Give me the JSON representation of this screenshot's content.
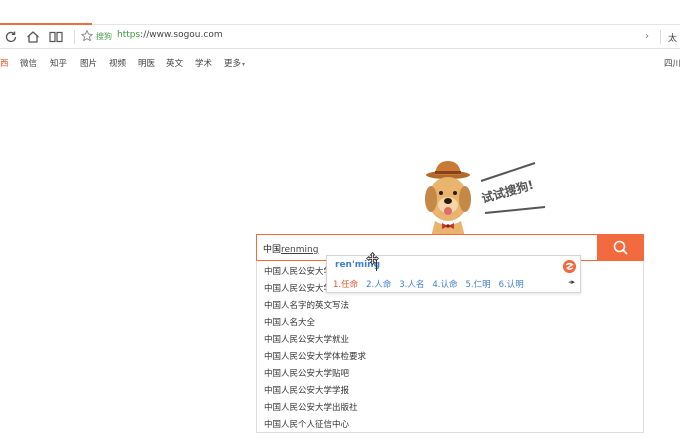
{
  "browser": {
    "url_scheme": "https",
    "url_rest": "://www.sogou.com",
    "site_tag": "搜狗",
    "right_text": "太",
    "chevron": "›"
  },
  "search_nav": {
    "items": [
      "西",
      "微信",
      "知乎",
      "图片",
      "视频",
      "明医",
      "英文",
      "学术",
      "更多"
    ],
    "more_arrow": "▾",
    "right_text": "四川"
  },
  "mascot": {
    "badge_text": "试试搜狗!"
  },
  "search": {
    "query_prefix": "中国",
    "query_composition": "renming"
  },
  "ime": {
    "composition": "ren'ming",
    "candidates": [
      "1.任命",
      "2.人命",
      "3.人名",
      "4.认命",
      "5.仁明",
      "6.认明"
    ],
    "left_arrow": "◂",
    "right_arrow": "▸"
  },
  "suggestions": [
    "中国人民公安大学",
    "中国人民公安大学",
    "中国人名字的英文写法",
    "中国人名大全",
    "中国人民公安大学就业",
    "中国人民公安大学体检要求",
    "中国人民公安大学贴吧",
    "中国人民公安大学学报",
    "中国人民公安大学出版社",
    "中国人民个人征信中心"
  ],
  "colors": {
    "accent": "#f26a3d",
    "ime_blue": "#3d7fd0",
    "url_green": "#3c9b3c"
  }
}
